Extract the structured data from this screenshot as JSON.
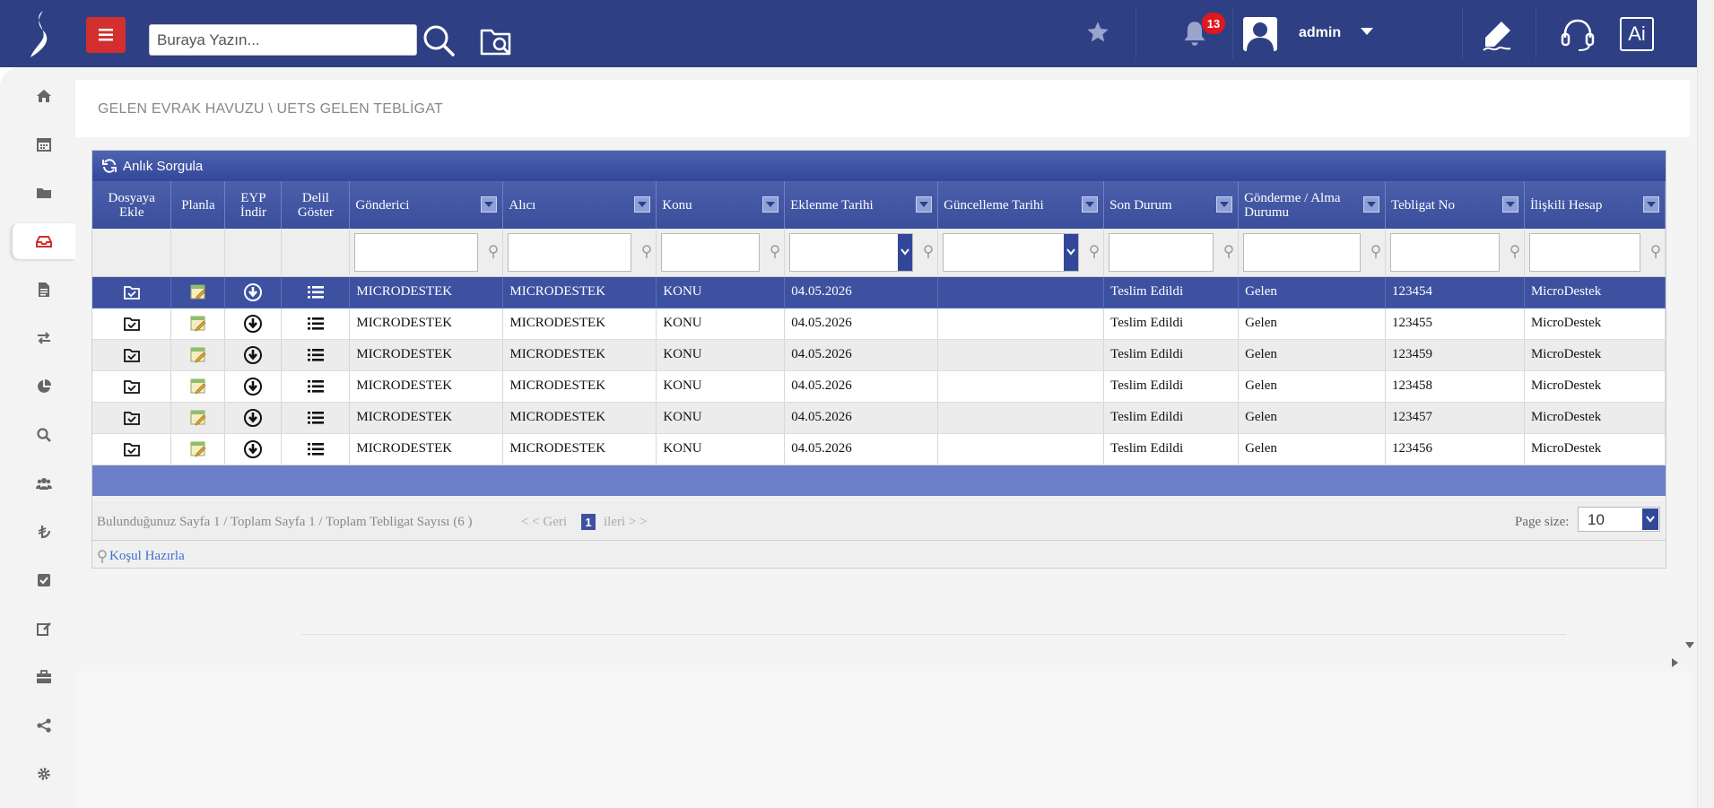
{
  "header": {
    "search_placeholder": "Buraya Yazın...",
    "notification_count": "13",
    "username": "admin",
    "ai_label": "Ai",
    "accent_color": "#2f3f84",
    "menu_color": "#d32f2f"
  },
  "sidebar": {
    "items": [
      {
        "icon": "home-icon"
      },
      {
        "icon": "calendar-icon"
      },
      {
        "icon": "folder-icon"
      },
      {
        "icon": "inbox-icon",
        "active": true
      },
      {
        "icon": "document-icon"
      },
      {
        "icon": "transfer-icon"
      },
      {
        "icon": "pie-chart-icon"
      },
      {
        "icon": "search-icon"
      },
      {
        "icon": "users-icon"
      },
      {
        "icon": "lira-icon"
      },
      {
        "icon": "checkbox-icon"
      },
      {
        "icon": "edit-icon"
      },
      {
        "icon": "briefcase-icon"
      },
      {
        "icon": "share-icon"
      },
      {
        "icon": "gear-icon"
      }
    ]
  },
  "page": {
    "breadcrumb": "GELEN EVRAK HAVUZU \\ UETS GELEN TEBLİGAT"
  },
  "grid": {
    "refresh_label": "Anlık Sorgula",
    "columns": [
      "Dosyaya Ekle",
      "Planla",
      "EYP İndir",
      "Delil Göster",
      "Gönderici",
      "Alıcı",
      "Konu",
      "Eklenme Tarihi",
      "Güncelleme Tarihi",
      "Son Durum",
      "Gönderme / Alma Durumu",
      "Tebligat No",
      "İlişkili Hesap"
    ],
    "rows": [
      {
        "gonderici": "MICRODESTEK",
        "alici": "MICRODESTEK",
        "konu": "KONU",
        "eklenme": "04.05.2026",
        "guncelleme": "",
        "son_durum": "Teslim Edildi",
        "durum": "Gelen",
        "tebligat_no": "123454",
        "hesap": "MicroDestek",
        "selected": true
      },
      {
        "gonderici": "MICRODESTEK",
        "alici": "MICRODESTEK",
        "konu": "KONU",
        "eklenme": "04.05.2026",
        "guncelleme": "",
        "son_durum": "Teslim Edildi",
        "durum": "Gelen",
        "tebligat_no": "123455",
        "hesap": "MicroDestek"
      },
      {
        "gonderici": "MICRODESTEK",
        "alici": "MICRODESTEK",
        "konu": "KONU",
        "eklenme": "04.05.2026",
        "guncelleme": "",
        "son_durum": "Teslim Edildi",
        "durum": "Gelen",
        "tebligat_no": "123459",
        "hesap": "MicroDestek"
      },
      {
        "gonderici": "MICRODESTEK",
        "alici": "MICRODESTEK",
        "konu": "KONU",
        "eklenme": "04.05.2026",
        "guncelleme": "",
        "son_durum": "Teslim Edildi",
        "durum": "Gelen",
        "tebligat_no": "123458",
        "hesap": "MicroDestek"
      },
      {
        "gonderici": "MICRODESTEK",
        "alici": "MICRODESTEK",
        "konu": "KONU",
        "eklenme": "04.05.2026",
        "guncelleme": "",
        "son_durum": "Teslim Edildi",
        "durum": "Gelen",
        "tebligat_no": "123457",
        "hesap": "MicroDestek"
      },
      {
        "gonderici": "MICRODESTEK",
        "alici": "MICRODESTEK",
        "konu": "KONU",
        "eklenme": "04.05.2026",
        "guncelleme": "",
        "son_durum": "Teslim Edildi",
        "durum": "Gelen",
        "tebligat_no": "123456",
        "hesap": "MicroDestek"
      }
    ]
  },
  "pager": {
    "summary": "Bulunduğunuz Sayfa 1 / Toplam Sayfa 1 / Toplam Tebligat Sayısı (6 )",
    "prev": "< < Geri",
    "current": "1",
    "next": "ileri > >",
    "page_size_label": "Page size:",
    "page_size": "10"
  },
  "condition_label": "Koşul Hazırla"
}
